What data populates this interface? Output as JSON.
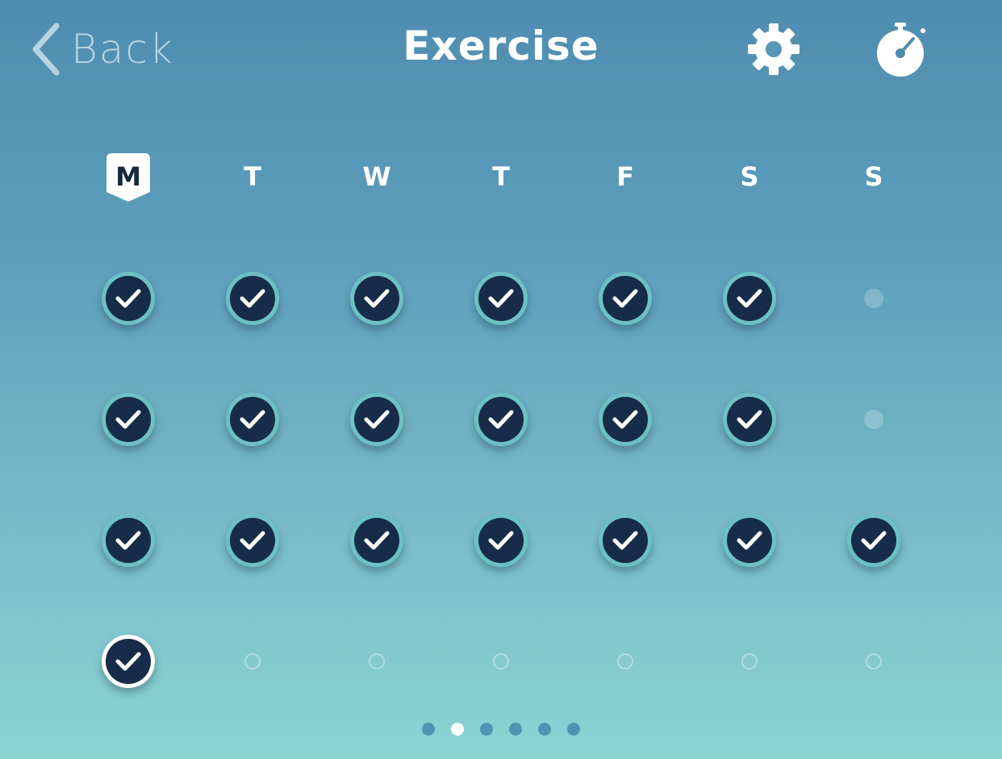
{
  "header": {
    "back_label": "Back",
    "title": "Exercise",
    "settings_icon": "gear-icon",
    "timer_icon": "stopwatch-icon"
  },
  "colors": {
    "background_top": "#4f8db0",
    "background_bottom": "#8ad5d4",
    "check_fill": "#162c48",
    "check_ring": "#6cc1c2",
    "today_ring": "#ffffff"
  },
  "week": {
    "days": [
      "M",
      "T",
      "W",
      "T",
      "F",
      "S",
      "S"
    ],
    "active_day_index": 0
  },
  "calendar": {
    "rows": [
      [
        "done",
        "done",
        "done",
        "done",
        "done",
        "done",
        "rest"
      ],
      [
        "done",
        "done",
        "done",
        "done",
        "done",
        "done",
        "rest"
      ],
      [
        "done",
        "done",
        "done",
        "done",
        "done",
        "done",
        "done"
      ],
      [
        "today",
        "future",
        "future",
        "future",
        "future",
        "future",
        "future"
      ]
    ]
  },
  "pager": {
    "count": 6,
    "active_index": 1
  }
}
